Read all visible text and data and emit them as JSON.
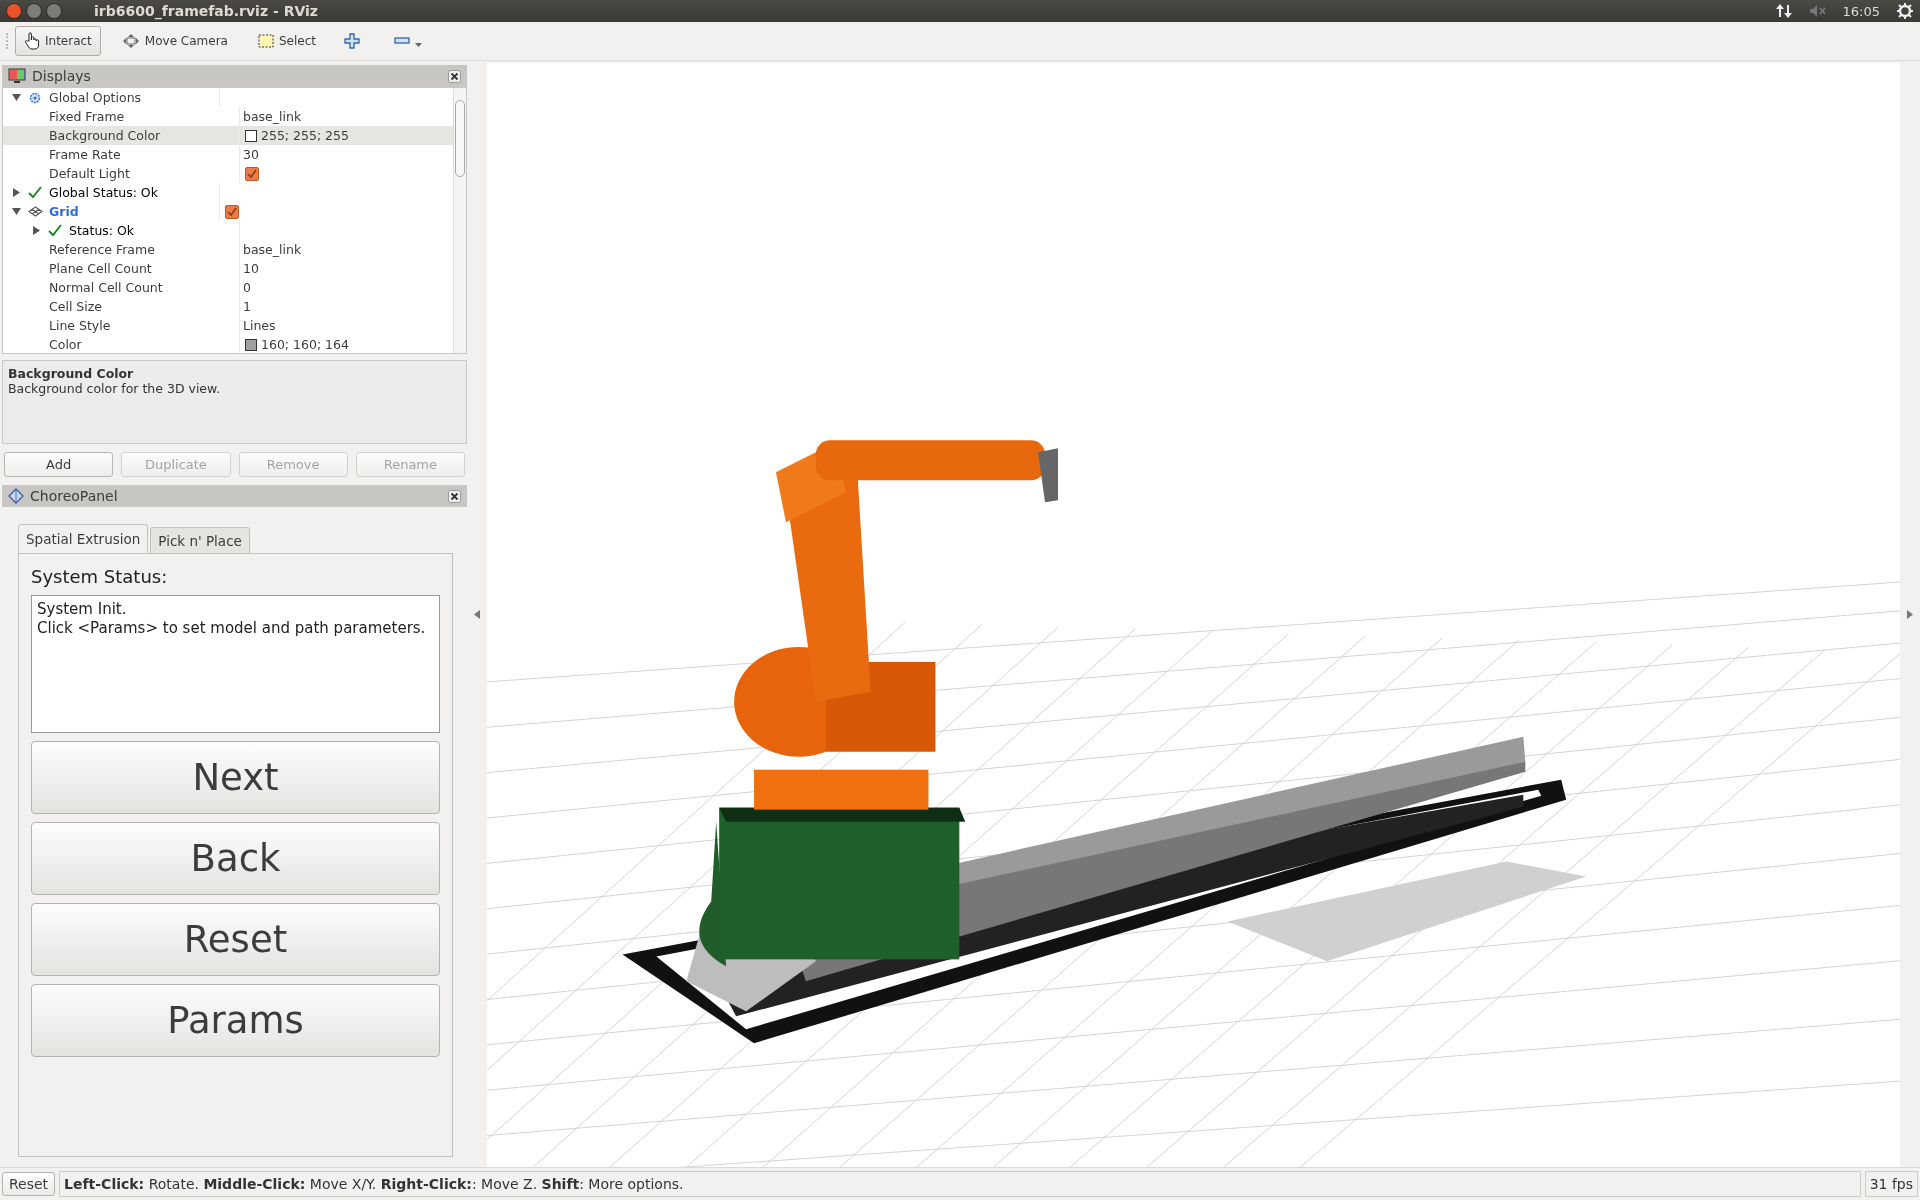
{
  "window": {
    "title": "irb6600_framefab.rviz - RViz"
  },
  "tray": {
    "time": "16:05"
  },
  "toolbar": {
    "tools": [
      {
        "label": "Interact",
        "kind": "interact",
        "selected": true
      },
      {
        "label": "Move Camera",
        "kind": "move-camera",
        "selected": false
      },
      {
        "label": "Select",
        "kind": "select",
        "selected": false
      }
    ]
  },
  "displays": {
    "title": "Displays",
    "tree": [
      {
        "label": "Global Options",
        "kind": "options",
        "expanded": true,
        "selected": false,
        "children": [
          {
            "label": "Fixed Frame",
            "kind": "property",
            "value": "base_link",
            "selected": false
          },
          {
            "label": "Background Color",
            "kind": "property",
            "value": "255; 255; 255",
            "color": "#ffffff",
            "selected": true
          },
          {
            "label": "Frame Rate",
            "kind": "property",
            "value": "30",
            "selected": false
          },
          {
            "label": "Default Light",
            "kind": "property",
            "checked": true,
            "selected": false
          }
        ]
      },
      {
        "label": "Global Status: Ok",
        "kind": "status",
        "expanded": false,
        "selected": false
      },
      {
        "label": "Grid",
        "kind": "display",
        "expanded": true,
        "checked": true,
        "selected": false,
        "children": [
          {
            "label": "Status: Ok",
            "kind": "status",
            "expanded": false,
            "selected": false
          },
          {
            "label": "Reference Frame",
            "kind": "property",
            "value": "base_link",
            "selected": false
          },
          {
            "label": "Plane Cell Count",
            "kind": "property",
            "value": "10",
            "selected": false
          },
          {
            "label": "Normal Cell Count",
            "kind": "property",
            "value": "0",
            "selected": false
          },
          {
            "label": "Cell Size",
            "kind": "property",
            "value": "1",
            "selected": false
          },
          {
            "label": "Line Style",
            "kind": "property",
            "value": "Lines",
            "selected": false
          },
          {
            "label": "Color",
            "kind": "property",
            "value": "160; 160; 164",
            "color": "#a0a0a4",
            "selected": false
          }
        ]
      }
    ],
    "description": {
      "title": "Background Color",
      "text": "Background color for the 3D view."
    },
    "buttons": [
      {
        "label": "Add",
        "disabled": false
      },
      {
        "label": "Duplicate",
        "disabled": true
      },
      {
        "label": "Remove",
        "disabled": true
      },
      {
        "label": "Rename",
        "disabled": true
      }
    ]
  },
  "choreo_panel": {
    "title": "ChoreoPanel",
    "tabs": [
      {
        "label": "Spatial Extrusion",
        "selected": true
      },
      {
        "label": "Pick n' Place",
        "selected": false
      }
    ],
    "status_label": "System Status:",
    "status_lines": [
      "System Init.",
      "Click <Params> to set model and path parameters."
    ],
    "buttons": [
      "Next",
      "Back",
      "Reset",
      "Params"
    ]
  },
  "status_bar": {
    "reset": "Reset",
    "hint": "**Left-Click:** Rotate. **Middle-Click:** Move X/Y. **Right-Click:**: Move Z. **Shift**: More options.",
    "fps": "31 fps"
  }
}
